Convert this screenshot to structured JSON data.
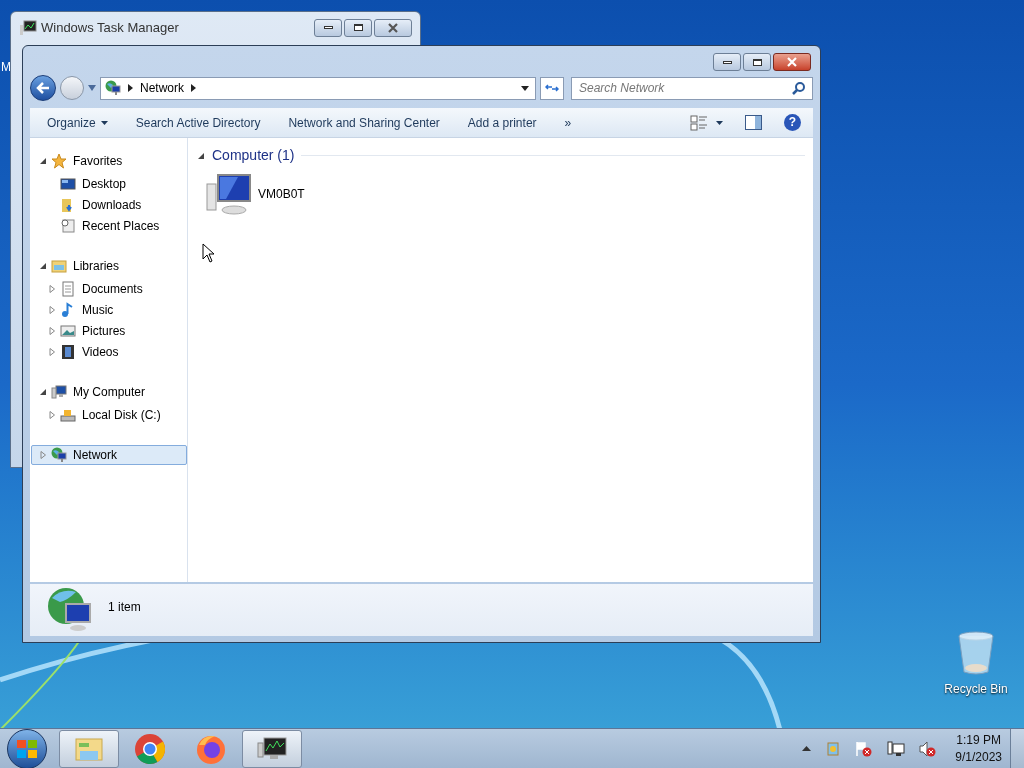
{
  "desktop": {
    "icons": [
      {
        "kind": "cut",
        "label": "M"
      },
      {
        "kind": "recycle-bin",
        "label": "Recycle Bin"
      }
    ]
  },
  "task_manager": {
    "title": "Windows Task Manager"
  },
  "explorer": {
    "address": {
      "crumbs": [
        "Network"
      ]
    },
    "search": {
      "placeholder": "Search Network"
    },
    "toolbar": [
      {
        "kind": "menu",
        "label": "Organize"
      },
      {
        "kind": "command",
        "label": "Search Active Directory"
      },
      {
        "kind": "command",
        "label": "Network and Sharing Center"
      },
      {
        "kind": "command",
        "label": "Add a printer"
      },
      {
        "kind": "command",
        "label": "»"
      }
    ],
    "sidebar": [
      {
        "kind": "favorites",
        "label": "Favorites",
        "expanded": true,
        "selected": false,
        "children": [
          {
            "kind": "desktop",
            "label": "Desktop",
            "selected": false
          },
          {
            "kind": "downloads",
            "label": "Downloads",
            "selected": false
          },
          {
            "kind": "recent",
            "label": "Recent Places",
            "selected": false
          }
        ]
      },
      {
        "kind": "libraries",
        "label": "Libraries",
        "expanded": true,
        "selected": false,
        "children": [
          {
            "kind": "documents",
            "label": "Documents",
            "expanded": false,
            "selected": false
          },
          {
            "kind": "music",
            "label": "Music",
            "expanded": false,
            "selected": false
          },
          {
            "kind": "pictures",
            "label": "Pictures",
            "expanded": false,
            "selected": false
          },
          {
            "kind": "videos",
            "label": "Videos",
            "expanded": false,
            "selected": false
          }
        ]
      },
      {
        "kind": "computer",
        "label": "My Computer",
        "expanded": true,
        "selected": false,
        "children": [
          {
            "kind": "disk",
            "label": "Local Disk (C:)",
            "expanded": false,
            "selected": false
          }
        ]
      },
      {
        "kind": "network",
        "label": "Network",
        "expanded": false,
        "selected": true
      }
    ],
    "help": "?",
    "groups": [
      {
        "title": "Computer (1)",
        "expanded": true,
        "items": [
          {
            "label": "VM0B0T"
          }
        ]
      }
    ],
    "status": "1 item"
  },
  "taskbar": {
    "apps": [
      {
        "kind": "explorer",
        "running": true
      },
      {
        "kind": "chrome",
        "running": false
      },
      {
        "kind": "firefox",
        "running": false
      },
      {
        "kind": "taskmgr",
        "running": true
      }
    ],
    "clock": {
      "time": "1:19 PM",
      "date": "9/1/2023"
    }
  }
}
